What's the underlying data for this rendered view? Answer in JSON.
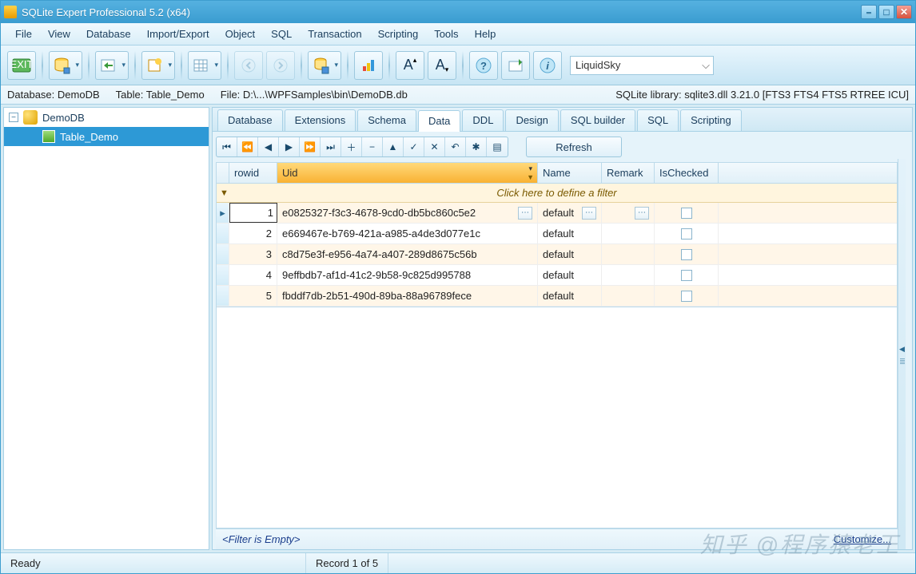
{
  "window": {
    "title": "SQLite Expert Professional 5.2 (x64)"
  },
  "menu": [
    "File",
    "View",
    "Database",
    "Import/Export",
    "Object",
    "SQL",
    "Transaction",
    "Scripting",
    "Tools",
    "Help"
  ],
  "skin": "LiquidSky",
  "info": {
    "database_label": "Database:",
    "database_name": "DemoDB",
    "table_label": "Table:",
    "table_name": "Table_Demo",
    "file_label": "File:",
    "file_path": "D:\\...\\WPFSamples\\bin\\DemoDB.db",
    "library": "SQLite library: sqlite3.dll 3.21.0 [FTS3 FTS4 FTS5 RTREE ICU]"
  },
  "tree": {
    "db": "DemoDB",
    "table": "Table_Demo"
  },
  "tabs": [
    "Database",
    "Extensions",
    "Schema",
    "Data",
    "DDL",
    "Design",
    "SQL builder",
    "SQL",
    "Scripting"
  ],
  "active_tab": 3,
  "refresh_label": "Refresh",
  "columns": [
    "rowid",
    "Uid",
    "Name",
    "Remark",
    "IsChecked"
  ],
  "filter_hint": "Click here to define a filter",
  "rows": [
    {
      "rowid": "1",
      "uid": "e0825327-f3c3-4678-9cd0-db5bc860c5e2",
      "name": "default",
      "remark": "",
      "checked": false
    },
    {
      "rowid": "2",
      "uid": "e669467e-b769-421a-a985-a4de3d077e1c",
      "name": "default",
      "remark": "",
      "checked": false
    },
    {
      "rowid": "3",
      "uid": "c8d75e3f-e956-4a74-a407-289d8675c56b",
      "name": "default",
      "remark": "",
      "checked": false
    },
    {
      "rowid": "4",
      "uid": "9effbdb7-af1d-41c2-9b58-9c825d995788",
      "name": "default",
      "remark": "",
      "checked": false
    },
    {
      "rowid": "5",
      "uid": "fbddf7db-2b51-490d-89ba-88a96789fece",
      "name": "default",
      "remark": "",
      "checked": false
    }
  ],
  "footer_filter": "<Filter is Empty>",
  "footer_customize": "Customize...",
  "status": {
    "ready": "Ready",
    "record": "Record 1 of 5"
  },
  "watermark": "知乎 @程序猿老王"
}
